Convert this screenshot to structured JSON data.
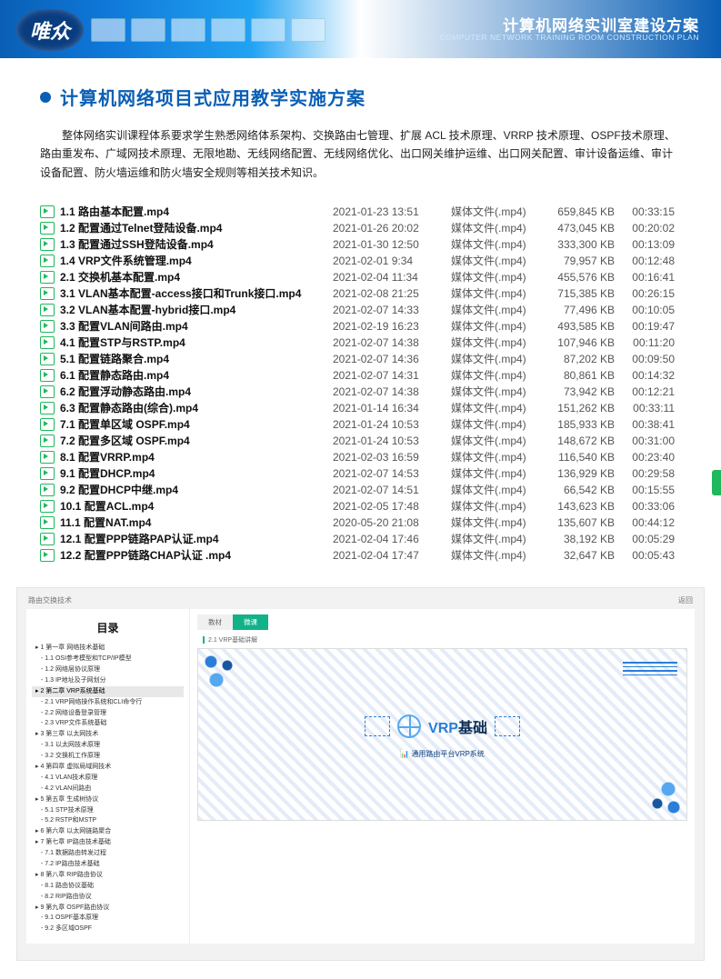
{
  "banner": {
    "logo": "唯众",
    "title_zh": "计算机网络实训室建设方案",
    "title_en": "COMPUTER NETWORK TRAINING ROOM CONSTRUCTION PLAN"
  },
  "section_title": "计算机网络项目式应用教学实施方案",
  "intro": "整体网络实训课程体系要求学生熟悉网络体系架构、交换路由七管理、扩展 ACL 技术原理、VRRP 技术原理、OSPF技术原理、路由重发布、广域网技术原理、无限地勘、无线网络配置、无线网络优化、出口网关维护运维、出口网关配置、审计设备运维、审计设备配置、防火墙运维和防火墙安全规则等相关技术知识。",
  "file_type_label": "媒体文件(.mp4)",
  "files": [
    {
      "name": "1.1 路由基本配置.mp4",
      "date": "2021-01-23 13:51",
      "size": "659,845 KB",
      "dur": "00:33:15"
    },
    {
      "name": "1.2 配置通过Telnet登陆设备.mp4",
      "date": "2021-01-26 20:02",
      "size": "473,045 KB",
      "dur": "00:20:02"
    },
    {
      "name": "1.3 配置通过SSH登陆设备.mp4",
      "date": "2021-01-30 12:50",
      "size": "333,300 KB",
      "dur": "00:13:09"
    },
    {
      "name": "1.4 VRP文件系统管理.mp4",
      "date": "2021-02-01 9:34",
      "size": "79,957 KB",
      "dur": "00:12:48"
    },
    {
      "name": "2.1 交换机基本配置.mp4",
      "date": "2021-02-04 11:34",
      "size": "455,576 KB",
      "dur": "00:16:41"
    },
    {
      "name": "3.1 VLAN基本配置-access接口和Trunk接口.mp4",
      "date": "2021-02-08 21:25",
      "size": "715,385 KB",
      "dur": "00:26:15"
    },
    {
      "name": "3.2 VLAN基本配置-hybrid接口.mp4",
      "date": "2021-02-07 14:33",
      "size": "77,496 KB",
      "dur": "00:10:05"
    },
    {
      "name": "3.3 配置VLAN间路由.mp4",
      "date": "2021-02-19 16:23",
      "size": "493,585 KB",
      "dur": "00:19:47"
    },
    {
      "name": "4.1 配置STP与RSTP.mp4",
      "date": "2021-02-07 14:38",
      "size": "107,946 KB",
      "dur": "00:11:20"
    },
    {
      "name": "5.1 配置链路聚合.mp4",
      "date": "2021-02-07 14:36",
      "size": "87,202 KB",
      "dur": "00:09:50"
    },
    {
      "name": "6.1 配置静态路由.mp4",
      "date": "2021-02-07 14:31",
      "size": "80,861 KB",
      "dur": "00:14:32"
    },
    {
      "name": "6.2 配置浮动静态路由.mp4",
      "date": "2021-02-07 14:38",
      "size": "73,942 KB",
      "dur": "00:12:21"
    },
    {
      "name": "6.3 配置静态路由(综合).mp4",
      "date": "2021-01-14 16:34",
      "size": "151,262 KB",
      "dur": "00:33:11"
    },
    {
      "name": "7.1 配置单区域 OSPF.mp4",
      "date": "2021-01-24 10:53",
      "size": "185,933 KB",
      "dur": "00:38:41"
    },
    {
      "name": "7.2 配置多区域 OSPF.mp4",
      "date": "2021-01-24 10:53",
      "size": "148,672 KB",
      "dur": "00:31:00"
    },
    {
      "name": "8.1 配置VRRP.mp4",
      "date": "2021-02-03 16:59",
      "size": "116,540 KB",
      "dur": "00:23:40"
    },
    {
      "name": "9.1 配置DHCP.mp4",
      "date": "2021-02-07 14:53",
      "size": "136,929 KB",
      "dur": "00:29:58"
    },
    {
      "name": "9.2 配置DHCP中继.mp4",
      "date": "2021-02-07 14:51",
      "size": "66,542 KB",
      "dur": "00:15:55"
    },
    {
      "name": "10.1 配置ACL.mp4",
      "date": "2021-02-05 17:48",
      "size": "143,623 KB",
      "dur": "00:33:06"
    },
    {
      "name": "11.1 配置NAT.mp4",
      "date": "2020-05-20 21:08",
      "size": "135,607 KB",
      "dur": "00:44:12"
    },
    {
      "name": "12.1 配置PPP链路PAP认证.mp4",
      "date": "2021-02-04 17:46",
      "size": "38,192 KB",
      "dur": "00:05:29"
    },
    {
      "name": "12.2 配置PPP链路CHAP认证 .mp4",
      "date": "2021-02-04 17:47",
      "size": "32,647 KB",
      "dur": "00:05:43"
    }
  ],
  "course": {
    "breadcrumb": "路由交换技术",
    "toc_title": "目录",
    "toc": [
      {
        "t": "1  第一章 网络技术基础",
        "c": true
      },
      {
        "t": "1.1  OSI参考模型和TCP/IP模型"
      },
      {
        "t": "1.2  网络层协议原理"
      },
      {
        "t": "1.3  IP地址及子网划分"
      },
      {
        "t": "2  第二章 VRP系统基础",
        "c": true,
        "active": true
      },
      {
        "t": "2.1  VRP网络操作系统和CLI命令行"
      },
      {
        "t": "2.2  网络设备登录管理"
      },
      {
        "t": "2.3  VRP文件系统基础"
      },
      {
        "t": "3  第三章 以太网技术",
        "c": true
      },
      {
        "t": "3.1  以太网技术原理"
      },
      {
        "t": "3.2  交换机工作原理"
      },
      {
        "t": "4  第四章 虚拟局域网技术",
        "c": true
      },
      {
        "t": "4.1  VLAN技术原理"
      },
      {
        "t": "4.2  VLAN间路由"
      },
      {
        "t": "5  第五章 生成树协议",
        "c": true
      },
      {
        "t": "5.1  STP技术原理"
      },
      {
        "t": "5.2  RSTP和MSTP"
      },
      {
        "t": "6  第六章 以太网链路聚合",
        "c": true
      },
      {
        "t": "7  第七章 IP路由技术基础",
        "c": true
      },
      {
        "t": "7.1  数据路由转发过程"
      },
      {
        "t": "7.2  IP路由技术基础"
      },
      {
        "t": "8  第八章 RIP路由协议",
        "c": true
      },
      {
        "t": "8.1  路由协议基础"
      },
      {
        "t": "8.2  RIP路由协议"
      },
      {
        "t": "9  第九章 OSPF路由协议",
        "c": true
      },
      {
        "t": "9.1  OSPF基本原理"
      },
      {
        "t": "9.2  多区域OSPF"
      }
    ],
    "tabs": {
      "tab1": "教材",
      "tab2": "微课"
    },
    "video_label": "2.1 VRP基础讲解",
    "slide_title_main": "VRP",
    "slide_title_suffix": "基础",
    "slide_sub": "通用路由平台VRP系统",
    "return_label": "返回"
  }
}
